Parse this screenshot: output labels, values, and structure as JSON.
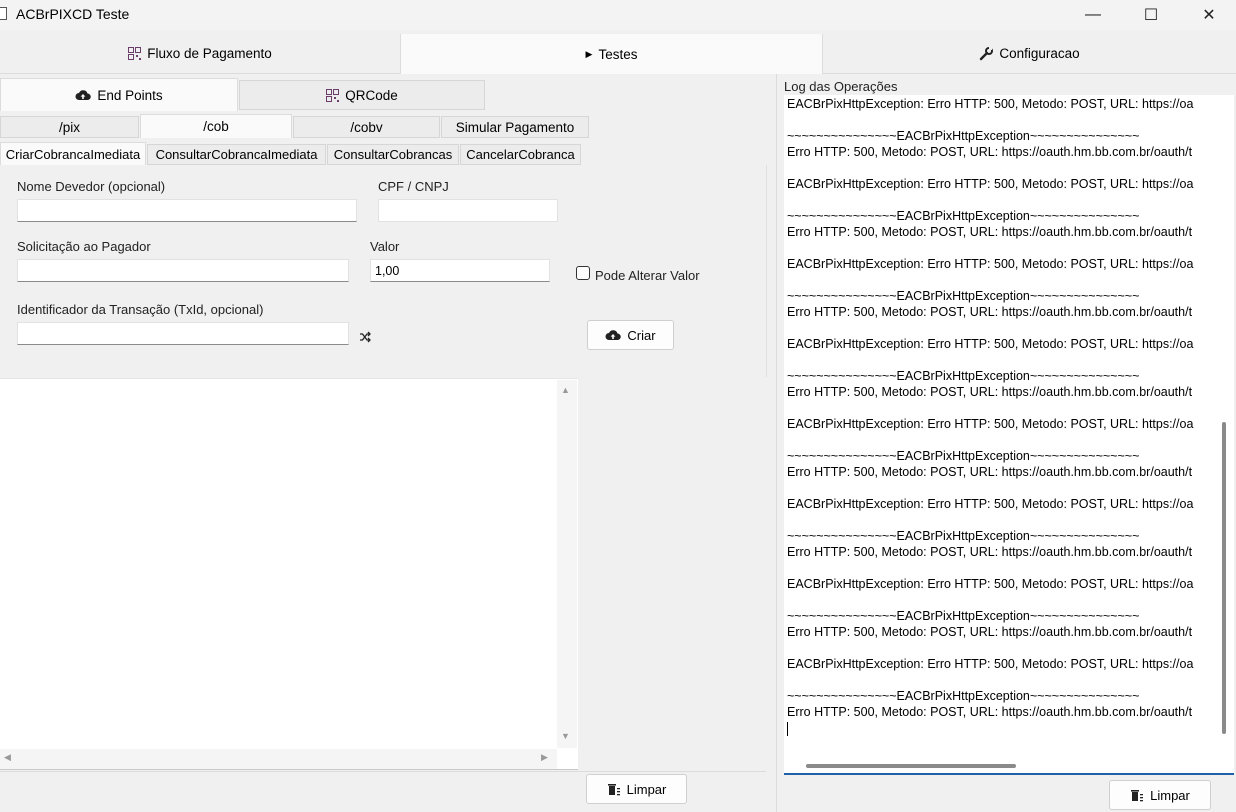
{
  "window": {
    "title": "ACBrPIXCD Teste",
    "minimize_glyph": "—",
    "maximize_glyph": "☐",
    "close_glyph": "✕"
  },
  "main_tabs": [
    {
      "label": "Fluxo de Pagamento",
      "icon": "qr-icon",
      "active": false
    },
    {
      "label": "Testes",
      "icon": "play-icon",
      "active": true
    },
    {
      "label": "Configuracao",
      "icon": "wrench-icon",
      "active": false
    }
  ],
  "endpoint_tabs": [
    {
      "label": "End Points",
      "icon": "cloud-icon",
      "active": true
    },
    {
      "label": "QRCode",
      "icon": "qr-icon",
      "active": false
    }
  ],
  "api_tabs": [
    {
      "label": "/pix",
      "active": false
    },
    {
      "label": "/cob",
      "active": true
    },
    {
      "label": "/cobv",
      "active": false
    },
    {
      "label": "Simular Pagamento",
      "active": false
    }
  ],
  "cob_tabs": [
    {
      "label": "CriarCobrancaImediata",
      "active": true
    },
    {
      "label": "ConsultarCobrancaImediata",
      "active": false
    },
    {
      "label": "ConsultarCobrancas",
      "active": false
    },
    {
      "label": "CancelarCobranca",
      "active": false
    }
  ],
  "form": {
    "nome_label": "Nome Devedor (opcional)",
    "nome_value": "",
    "cpf_label": "CPF / CNPJ",
    "cpf_value": "",
    "solicitacao_label": "Solicitação ao Pagador",
    "solicitacao_value": "",
    "valor_label": "Valor",
    "valor_value": "1,00",
    "pode_alterar_label": "Pode Alterar Valor",
    "pode_alterar_checked": false,
    "txid_label": "Identificador da Transação (TxId, opcional)",
    "txid_value": "",
    "criar_label": "Criar"
  },
  "result_panel": {
    "limpar_label": "Limpar"
  },
  "log": {
    "title": "Log das Operações",
    "limpar_label": "Limpar",
    "lines": [
      "EACBrPixHttpException: Erro HTTP: 500, Metodo: POST, URL: https://oa",
      "",
      "~~~~~~~~~~~~~~~EACBrPixHttpException~~~~~~~~~~~~~~~",
      "Erro HTTP: 500, Metodo: POST, URL: https://oauth.hm.bb.com.br/oauth/t",
      "",
      "EACBrPixHttpException: Erro HTTP: 500, Metodo: POST, URL: https://oa",
      "",
      "~~~~~~~~~~~~~~~EACBrPixHttpException~~~~~~~~~~~~~~~",
      "Erro HTTP: 500, Metodo: POST, URL: https://oauth.hm.bb.com.br/oauth/t",
      "",
      "EACBrPixHttpException: Erro HTTP: 500, Metodo: POST, URL: https://oa",
      "",
      "~~~~~~~~~~~~~~~EACBrPixHttpException~~~~~~~~~~~~~~~",
      "Erro HTTP: 500, Metodo: POST, URL: https://oauth.hm.bb.com.br/oauth/t",
      "",
      "EACBrPixHttpException: Erro HTTP: 500, Metodo: POST, URL: https://oa",
      "",
      "~~~~~~~~~~~~~~~EACBrPixHttpException~~~~~~~~~~~~~~~",
      "Erro HTTP: 500, Metodo: POST, URL: https://oauth.hm.bb.com.br/oauth/t",
      "",
      "EACBrPixHttpException: Erro HTTP: 500, Metodo: POST, URL: https://oa",
      "",
      "~~~~~~~~~~~~~~~EACBrPixHttpException~~~~~~~~~~~~~~~",
      "Erro HTTP: 500, Metodo: POST, URL: https://oauth.hm.bb.com.br/oauth/t",
      "",
      "EACBrPixHttpException: Erro HTTP: 500, Metodo: POST, URL: https://oa",
      "",
      "~~~~~~~~~~~~~~~EACBrPixHttpException~~~~~~~~~~~~~~~",
      "Erro HTTP: 500, Metodo: POST, URL: https://oauth.hm.bb.com.br/oauth/t",
      "",
      "EACBrPixHttpException: Erro HTTP: 500, Metodo: POST, URL: https://oa",
      "",
      "~~~~~~~~~~~~~~~EACBrPixHttpException~~~~~~~~~~~~~~~",
      "Erro HTTP: 500, Metodo: POST, URL: https://oauth.hm.bb.com.br/oauth/t",
      "",
      "EACBrPixHttpException: Erro HTTP: 500, Metodo: POST, URL: https://oa",
      "",
      "~~~~~~~~~~~~~~~EACBrPixHttpException~~~~~~~~~~~~~~~",
      "Erro HTTP: 500, Metodo: POST, URL: https://oauth.hm.bb.com.br/oauth/t"
    ]
  }
}
